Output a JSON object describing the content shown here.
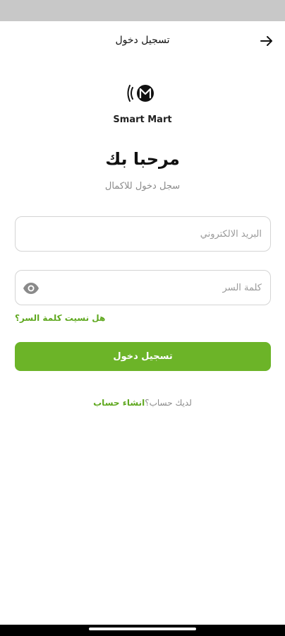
{
  "header": {
    "title": "تسجيل دخول",
    "back_icon": "arrow-right-icon"
  },
  "brand": {
    "logo_icon": "smart-mart-logo-icon",
    "name": "Smart Mart"
  },
  "welcome": {
    "title": "مرحبا بك",
    "subtitle": "سجل دخول للاكمال"
  },
  "form": {
    "email_placeholder": "البريد الالكتروني",
    "email_value": "",
    "password_placeholder": "كلمة السر",
    "password_value": "",
    "password_toggle_icon": "eye-icon",
    "forgot_label": "هل نسيت كلمة السر؟",
    "login_label": "تسجيل دخول"
  },
  "signup": {
    "question": "لديك حساب؟",
    "link": "انشاء حساب"
  },
  "colors": {
    "accent": "#6cb428",
    "link": "#5fa81f",
    "status_bar": "#c8c8c8"
  }
}
